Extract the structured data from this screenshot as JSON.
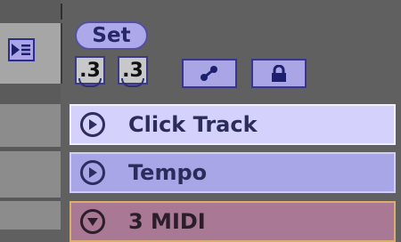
{
  "controls": {
    "set_label": "Set",
    "num_left": ".3",
    "num_right": ".3"
  },
  "icons": {
    "toggle": "play-list-icon",
    "curve": "automation-curve-icon",
    "lock": "lock-icon"
  },
  "tracks": [
    {
      "name": "Click Track",
      "state": "collapsed",
      "color": "#d4d1fc"
    },
    {
      "name": "Tempo",
      "state": "collapsed",
      "color": "#a9a6e8"
    },
    {
      "name": "3 MIDI",
      "state": "expanded",
      "color": "#a97894"
    }
  ]
}
